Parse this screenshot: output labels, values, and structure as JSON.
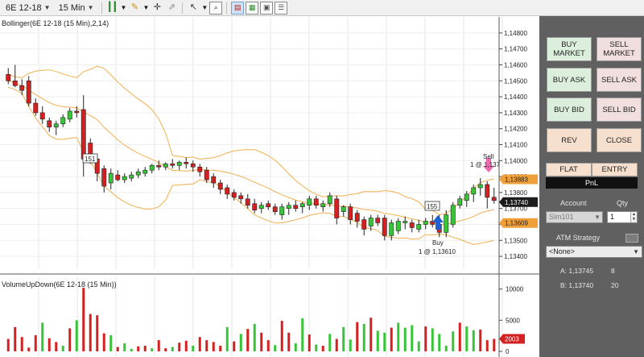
{
  "toolbar": {
    "instrument": "6E 12-18",
    "interval": "15 Min",
    "icons": [
      "crosshair-icon",
      "pencil-icon",
      "candlestick-icon",
      "magnet-icon",
      "pointer-icon",
      "zoom-icon",
      "chart-style-icon",
      "template-icon",
      "indicators-icon",
      "properties-icon"
    ]
  },
  "chart": {
    "price_title": "Bollinger(6E 12-18 (15 Min),2,14)",
    "volume_title": "VolumeUpDown(6E 12-18 (15 Min))",
    "markers": {
      "sell_label": "Sell",
      "sell_detail": "1 @ 1,137",
      "buy_label": "Buy",
      "buy_detail": "1 @ 1,13610",
      "bar_count_1": "151",
      "bar_count_2": "155"
    },
    "price_tags": {
      "upper": "1,13883",
      "last": "1,13740",
      "lower": "1,13609",
      "volume_last": "2003"
    },
    "colors": {
      "up": "#38c438",
      "down": "#d42020",
      "band": "#f0b050",
      "upper_tag": "#f0a038",
      "last_tag": "#1c1c1c",
      "vol_tag": "#d42020"
    }
  },
  "chart_data": {
    "type": "candlestick",
    "price_axis": {
      "ticks": [
        "1,14800",
        "1,14700",
        "1,14600",
        "1,14500",
        "1,14400",
        "1,14300",
        "1,14200",
        "1,14100",
        "1,14000",
        "1,13900",
        "1,13800",
        "1,13700",
        "1,13600",
        "1,13500",
        "1,13400"
      ],
      "ylim": [
        1.1336,
        1.1485
      ]
    },
    "volume_axis": {
      "ticks": [
        "10000",
        "5000",
        "0"
      ],
      "ylim": [
        0,
        11000
      ]
    },
    "candles": [
      {
        "o": 1.1454,
        "h": 1.1458,
        "l": 1.1448,
        "c": 1.145
      },
      {
        "o": 1.145,
        "h": 1.146,
        "l": 1.1446,
        "c": 1.1447
      },
      {
        "o": 1.1447,
        "h": 1.1451,
        "l": 1.1441,
        "c": 1.1444
      },
      {
        "o": 1.145,
        "h": 1.1453,
        "l": 1.1434,
        "c": 1.1436
      },
      {
        "o": 1.1436,
        "h": 1.1439,
        "l": 1.1428,
        "c": 1.143
      },
      {
        "o": 1.143,
        "h": 1.1434,
        "l": 1.1423,
        "c": 1.1426
      },
      {
        "o": 1.1425,
        "h": 1.1427,
        "l": 1.1418,
        "c": 1.1421
      },
      {
        "o": 1.1421,
        "h": 1.1425,
        "l": 1.1416,
        "c": 1.1423
      },
      {
        "o": 1.1423,
        "h": 1.1429,
        "l": 1.1421,
        "c": 1.1427
      },
      {
        "o": 1.1426,
        "h": 1.1433,
        "l": 1.1424,
        "c": 1.1431
      },
      {
        "o": 1.1431,
        "h": 1.1434,
        "l": 1.1427,
        "c": 1.143
      },
      {
        "o": 1.1432,
        "h": 1.1441,
        "l": 1.139,
        "c": 1.1401
      },
      {
        "o": 1.1411,
        "h": 1.1414,
        "l": 1.1398,
        "c": 1.1401
      },
      {
        "o": 1.1401,
        "h": 1.1403,
        "l": 1.1387,
        "c": 1.1392
      },
      {
        "o": 1.1395,
        "h": 1.1397,
        "l": 1.138,
        "c": 1.1384
      },
      {
        "o": 1.1386,
        "h": 1.1395,
        "l": 1.1382,
        "c": 1.1392
      },
      {
        "o": 1.1391,
        "h": 1.1394,
        "l": 1.1387,
        "c": 1.1388
      },
      {
        "o": 1.1388,
        "h": 1.1392,
        "l": 1.1386,
        "c": 1.139
      },
      {
        "o": 1.1389,
        "h": 1.1393,
        "l": 1.1387,
        "c": 1.1391
      },
      {
        "o": 1.1391,
        "h": 1.1395,
        "l": 1.1389,
        "c": 1.1393
      },
      {
        "o": 1.1392,
        "h": 1.1396,
        "l": 1.139,
        "c": 1.1394
      },
      {
        "o": 1.1394,
        "h": 1.1398,
        "l": 1.1392,
        "c": 1.1397
      },
      {
        "o": 1.1397,
        "h": 1.14,
        "l": 1.1394,
        "c": 1.1396
      },
      {
        "o": 1.1396,
        "h": 1.1399,
        "l": 1.1394,
        "c": 1.1398
      },
      {
        "o": 1.1398,
        "h": 1.1401,
        "l": 1.1395,
        "c": 1.1397
      },
      {
        "o": 1.1397,
        "h": 1.14,
        "l": 1.1394,
        "c": 1.1399
      },
      {
        "o": 1.1399,
        "h": 1.1402,
        "l": 1.1395,
        "c": 1.1398
      },
      {
        "o": 1.1398,
        "h": 1.14,
        "l": 1.1393,
        "c": 1.1396
      },
      {
        "o": 1.1396,
        "h": 1.1398,
        "l": 1.139,
        "c": 1.1393
      },
      {
        "o": 1.1394,
        "h": 1.1396,
        "l": 1.1386,
        "c": 1.1388
      },
      {
        "o": 1.139,
        "h": 1.1392,
        "l": 1.1383,
        "c": 1.1386
      },
      {
        "o": 1.1386,
        "h": 1.1388,
        "l": 1.1379,
        "c": 1.1382
      },
      {
        "o": 1.1383,
        "h": 1.1385,
        "l": 1.1376,
        "c": 1.1379
      },
      {
        "o": 1.138,
        "h": 1.1382,
        "l": 1.1375,
        "c": 1.1377
      },
      {
        "o": 1.1378,
        "h": 1.138,
        "l": 1.1373,
        "c": 1.1376
      },
      {
        "o": 1.1376,
        "h": 1.1379,
        "l": 1.137,
        "c": 1.1372
      },
      {
        "o": 1.1373,
        "h": 1.1376,
        "l": 1.1367,
        "c": 1.1369
      },
      {
        "o": 1.137,
        "h": 1.1374,
        "l": 1.1367,
        "c": 1.1372
      },
      {
        "o": 1.1373,
        "h": 1.1375,
        "l": 1.1369,
        "c": 1.1371
      },
      {
        "o": 1.1371,
        "h": 1.1373,
        "l": 1.1366,
        "c": 1.1368
      },
      {
        "o": 1.1366,
        "h": 1.1373,
        "l": 1.1363,
        "c": 1.1371
      },
      {
        "o": 1.137,
        "h": 1.1374,
        "l": 1.1366,
        "c": 1.1372
      },
      {
        "o": 1.1372,
        "h": 1.1375,
        "l": 1.1368,
        "c": 1.137
      },
      {
        "o": 1.1371,
        "h": 1.1374,
        "l": 1.1367,
        "c": 1.1373
      },
      {
        "o": 1.1372,
        "h": 1.1378,
        "l": 1.1369,
        "c": 1.1376
      },
      {
        "o": 1.1376,
        "h": 1.1378,
        "l": 1.137,
        "c": 1.1372
      },
      {
        "o": 1.1371,
        "h": 1.1375,
        "l": 1.1368,
        "c": 1.1373
      },
      {
        "o": 1.1373,
        "h": 1.138,
        "l": 1.1371,
        "c": 1.1378
      },
      {
        "o": 1.1376,
        "h": 1.1378,
        "l": 1.136,
        "c": 1.1364
      },
      {
        "o": 1.1368,
        "h": 1.1372,
        "l": 1.1365,
        "c": 1.1371
      },
      {
        "o": 1.1371,
        "h": 1.1373,
        "l": 1.136,
        "c": 1.1363
      },
      {
        "o": 1.1367,
        "h": 1.1369,
        "l": 1.1358,
        "c": 1.1362
      },
      {
        "o": 1.1363,
        "h": 1.1365,
        "l": 1.1353,
        "c": 1.1357
      },
      {
        "o": 1.1359,
        "h": 1.1366,
        "l": 1.1356,
        "c": 1.1364
      },
      {
        "o": 1.1364,
        "h": 1.1366,
        "l": 1.1359,
        "c": 1.1361
      },
      {
        "o": 1.1364,
        "h": 1.1366,
        "l": 1.135,
        "c": 1.1353
      },
      {
        "o": 1.1353,
        "h": 1.1363,
        "l": 1.135,
        "c": 1.1361
      },
      {
        "o": 1.1356,
        "h": 1.1364,
        "l": 1.1354,
        "c": 1.1362
      },
      {
        "o": 1.1361,
        "h": 1.1365,
        "l": 1.1357,
        "c": 1.1362
      },
      {
        "o": 1.1361,
        "h": 1.1363,
        "l": 1.1355,
        "c": 1.1358
      },
      {
        "o": 1.1357,
        "h": 1.1363,
        "l": 1.1355,
        "c": 1.136
      },
      {
        "o": 1.136,
        "h": 1.1364,
        "l": 1.1357,
        "c": 1.1362
      },
      {
        "o": 1.1362,
        "h": 1.1366,
        "l": 1.1358,
        "c": 1.136
      },
      {
        "o": 1.136,
        "h": 1.1366,
        "l": 1.1352,
        "c": 1.1355
      },
      {
        "o": 1.1355,
        "h": 1.1369,
        "l": 1.1352,
        "c": 1.1366
      },
      {
        "o": 1.136,
        "h": 1.1374,
        "l": 1.1358,
        "c": 1.1372
      },
      {
        "o": 1.1372,
        "h": 1.1378,
        "l": 1.137,
        "c": 1.1376
      },
      {
        "o": 1.1375,
        "h": 1.1381,
        "l": 1.1371,
        "c": 1.1379
      },
      {
        "o": 1.1379,
        "h": 1.1385,
        "l": 1.1374,
        "c": 1.1383
      },
      {
        "o": 1.1383,
        "h": 1.1389,
        "l": 1.1378,
        "c": 1.1385
      },
      {
        "o": 1.1385,
        "h": 1.1387,
        "l": 1.137,
        "c": 1.1377
      },
      {
        "o": 1.1377,
        "h": 1.1383,
        "l": 1.1373,
        "c": 1.1375
      }
    ],
    "volume_up": [
      0,
      3900,
      2300,
      600,
      2600,
      4600,
      2100,
      1500,
      900,
      3700,
      5000,
      10200,
      6000,
      5800,
      2900,
      2600,
      700,
      1300,
      400,
      800,
      900,
      500,
      1800,
      500,
      700,
      1400,
      1700,
      900,
      2300,
      1800,
      1500,
      900,
      3900,
      1600,
      2800,
      3600,
      4400,
      3000,
      1800,
      1000,
      4900,
      3000,
      1300,
      5300,
      2700,
      1100,
      900,
      2800,
      2000,
      3900,
      1900,
      4700,
      4400,
      5400,
      3300,
      3000,
      3800,
      4600,
      3800,
      4200,
      1600,
      4000,
      3700,
      2800,
      900,
      3200,
      4600,
      4000,
      3400,
      3500,
      1800,
      2000
    ],
    "volume_down": [
      2000,
      3900,
      2300,
      600,
      2600,
      4600,
      2100,
      1500,
      900,
      3700,
      5000,
      10200,
      6000,
      5800,
      2900,
      2600,
      700,
      1300,
      400,
      800,
      900,
      500,
      1800,
      500,
      700,
      1400,
      1700,
      900,
      2300,
      1800,
      1500,
      900,
      3900,
      1600,
      2800,
      3600,
      4400,
      3000,
      1800,
      1000,
      4900,
      3000,
      1300,
      5300,
      2700,
      1100,
      900,
      2800,
      2000,
      3900,
      1900,
      4700,
      4400,
      5400,
      3300,
      3000,
      3800,
      4600,
      3800,
      4200,
      1600,
      4000,
      3700,
      2800,
      900,
      3200,
      4600,
      4000,
      3400,
      3500,
      1800,
      2003
    ],
    "volume_colors": [
      "d",
      "d",
      "d",
      "d",
      "d",
      "u",
      "d",
      "d",
      "u",
      "d",
      "u",
      "d",
      "d",
      "d",
      "d",
      "u",
      "d",
      "u",
      "u",
      "d",
      "d",
      "u",
      "d",
      "d",
      "u",
      "d",
      "d",
      "u",
      "d",
      "d",
      "d",
      "d",
      "u",
      "d",
      "u",
      "d",
      "u",
      "d",
      "d",
      "u",
      "d",
      "d",
      "u",
      "u",
      "d",
      "u",
      "d",
      "u",
      "d",
      "u",
      "u",
      "d",
      "u",
      "d",
      "u",
      "u",
      "d",
      "u",
      "u",
      "u",
      "u",
      "d",
      "u",
      "u",
      "u",
      "u",
      "d",
      "u",
      "u",
      "d",
      "d",
      "d"
    ]
  },
  "panel": {
    "buttons": {
      "buy_market": "BUY MARKET",
      "sell_market": "SELL MARKET",
      "buy_ask": "BUY ASK",
      "sell_ask": "SELL ASK",
      "buy_bid": "BUY BID",
      "sell_bid": "SELL BID",
      "rev": "REV",
      "close": "CLOSE",
      "flat": "FLAT",
      "entry": "ENTRY"
    },
    "pnl": "PnL",
    "account_label": "Account",
    "qty_label": "Qty",
    "account_value": "Sim101",
    "qty_value": "1",
    "atm_label": "ATM Strategy",
    "atm_value": "<None>",
    "ask_label": "A: 1,13745",
    "ask_size": "8",
    "bid_label": "B: 1,13740",
    "bid_size": "20"
  }
}
